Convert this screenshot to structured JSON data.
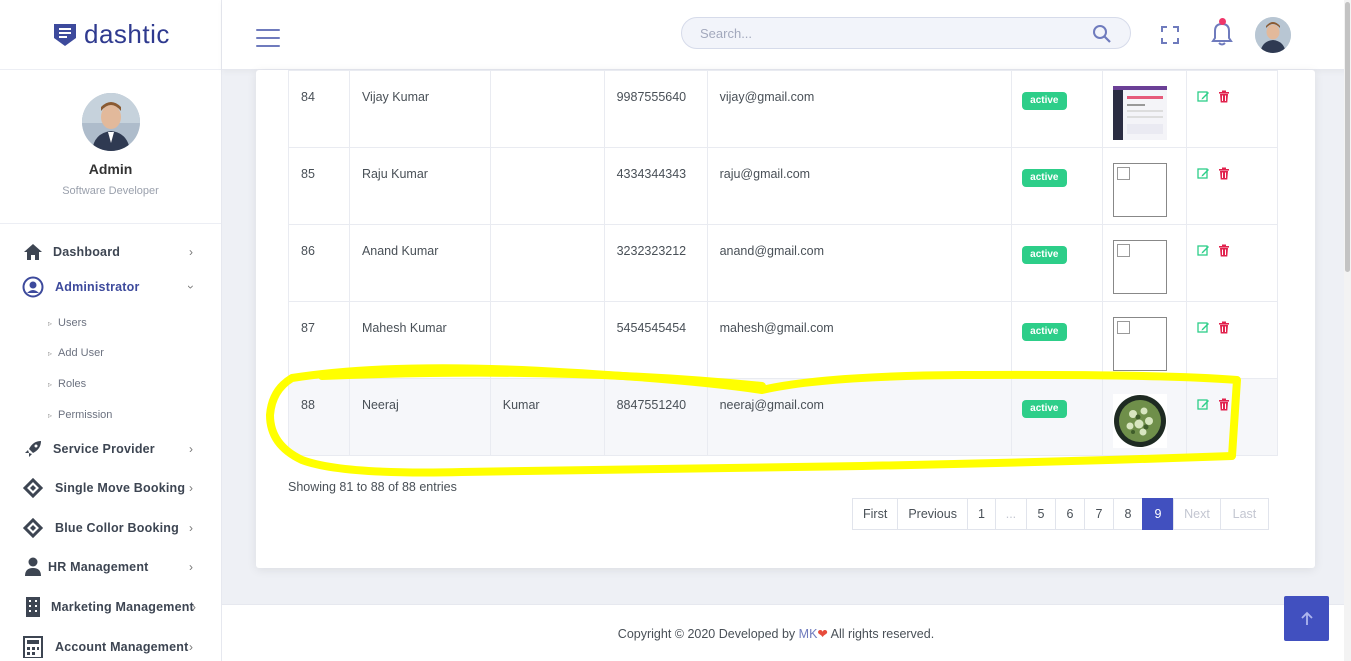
{
  "brand": {
    "name": "dashtic"
  },
  "profile": {
    "name": "Admin",
    "role": "Software Developer"
  },
  "sidebar": {
    "items": [
      {
        "label": "Dashboard",
        "icon": "home-icon"
      },
      {
        "label": "Administrator",
        "icon": "user-circle-icon",
        "expanded": true
      },
      {
        "label": "Service Provider",
        "icon": "rocket-icon"
      },
      {
        "label": "Single Move Booking",
        "icon": "ticket-icon"
      },
      {
        "label": "Blue Collor Booking",
        "icon": "ticket-icon"
      },
      {
        "label": "HR Management",
        "icon": "person-icon"
      },
      {
        "label": "Marketing Management",
        "icon": "building-icon"
      },
      {
        "label": "Account Management",
        "icon": "calculator-icon"
      }
    ],
    "subitems": [
      "Users",
      "Add User",
      "Roles",
      "Permission"
    ]
  },
  "search": {
    "placeholder": "Search..."
  },
  "table": {
    "rows": [
      {
        "id": "84",
        "first": "Vijay Kumar",
        "last": "",
        "phone": "9987555640",
        "email": "vijay@gmail.com",
        "status": "active",
        "image": "screenshot"
      },
      {
        "id": "85",
        "first": "Raju Kumar",
        "last": "",
        "phone": "4334344343",
        "email": "raju@gmail.com",
        "status": "active",
        "image": "broken"
      },
      {
        "id": "86",
        "first": "Anand Kumar",
        "last": "",
        "phone": "3232323212",
        "email": "anand@gmail.com",
        "status": "active",
        "image": "broken"
      },
      {
        "id": "87",
        "first": "Mahesh Kumar",
        "last": "",
        "phone": "5454545454",
        "email": "mahesh@gmail.com",
        "status": "active",
        "image": "broken"
      },
      {
        "id": "88",
        "first": "Neeraj",
        "last": "Kumar",
        "phone": "8847551240",
        "email": "neeraj@gmail.com",
        "status": "active",
        "image": "food-photo"
      }
    ]
  },
  "table_info": "Showing 81 to 88 of 88 entries",
  "pagination": {
    "first": "First",
    "previous": "Previous",
    "pages": [
      "1",
      "...",
      "5",
      "6",
      "7",
      "8",
      "9"
    ],
    "current": "9",
    "next": "Next",
    "last": "Last"
  },
  "footer": {
    "prefix": "Copyright © 2020 Developed by ",
    "author": "MK",
    "suffix": " All rights reserved."
  },
  "colors": {
    "primary": "#4150bf",
    "success": "#2dce89",
    "danger": "#e1224d",
    "highlight": "#ffff00"
  }
}
